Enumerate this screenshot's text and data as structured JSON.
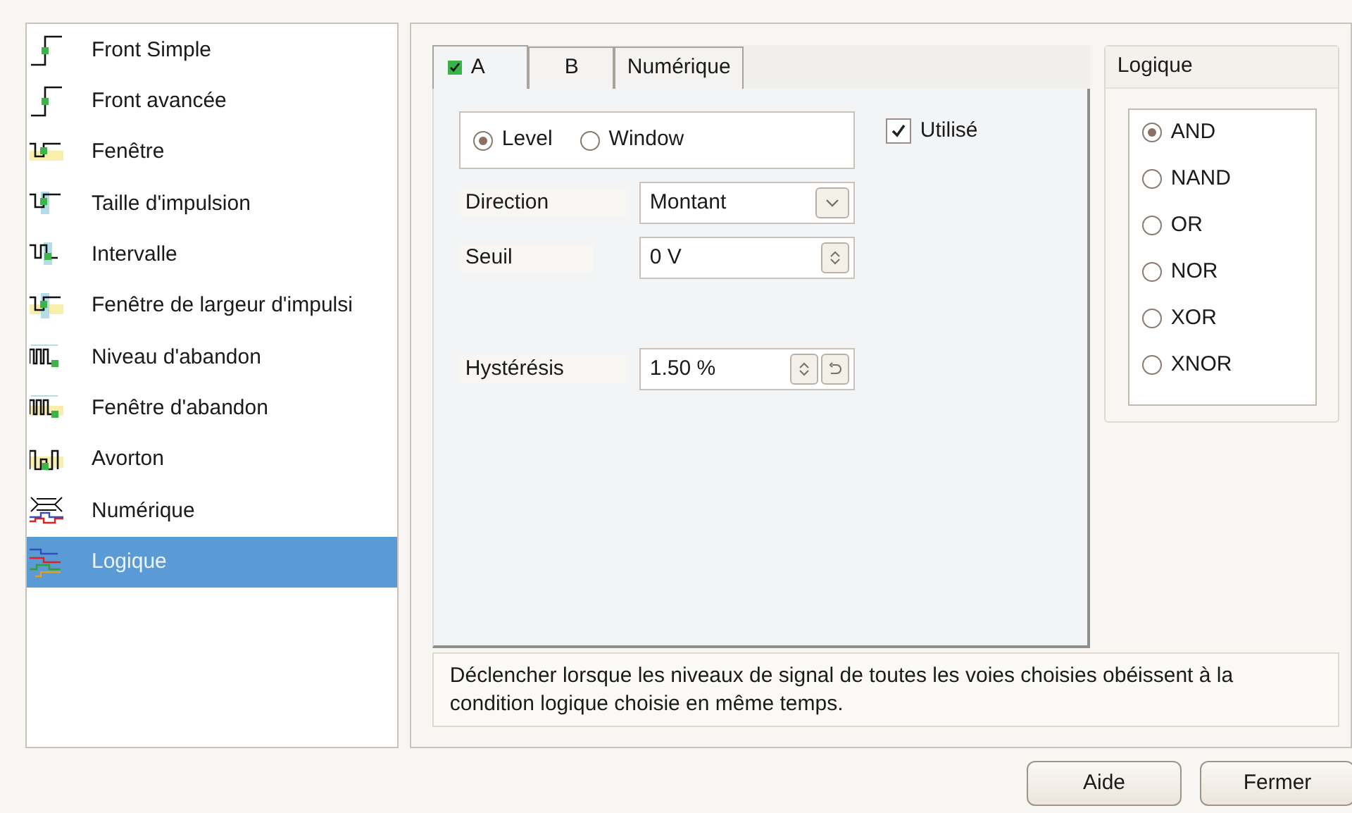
{
  "trigger_types": [
    {
      "label": "Front Simple",
      "selected": false
    },
    {
      "label": "Front avancée",
      "selected": false
    },
    {
      "label": "Fenêtre",
      "selected": false
    },
    {
      "label": "Taille d'impulsion",
      "selected": false
    },
    {
      "label": "Intervalle",
      "selected": false
    },
    {
      "label": "Fenêtre de largeur d'impulsi",
      "selected": false
    },
    {
      "label": "Niveau d'abandon",
      "selected": false
    },
    {
      "label": "Fenêtre d'abandon",
      "selected": false
    },
    {
      "label": "Avorton",
      "selected": false
    },
    {
      "label": "Numérique",
      "selected": false
    },
    {
      "label": "Logique",
      "selected": true
    }
  ],
  "tabs": [
    {
      "label": "A",
      "selected": true,
      "checked": true
    },
    {
      "label": "B",
      "selected": false
    },
    {
      "label": "Numérique",
      "selected": false
    }
  ],
  "mode": [
    {
      "label": "Level",
      "selected": true
    },
    {
      "label": "Window",
      "selected": false
    }
  ],
  "used": {
    "label": "Utilisé",
    "checked": true
  },
  "fields": [
    {
      "kind": "select",
      "label": "Direction",
      "value": "Montant"
    },
    {
      "kind": "spin",
      "label": "Seuil",
      "value": "0 V"
    },
    {
      "kind": "spin-reset",
      "label": "Hystérésis",
      "value": "1.50 %"
    }
  ],
  "logic": {
    "title": "Logique",
    "options": [
      {
        "label": "AND",
        "selected": true
      },
      {
        "label": "NAND",
        "selected": false
      },
      {
        "label": "OR",
        "selected": false
      },
      {
        "label": "NOR",
        "selected": false
      },
      {
        "label": "XOR",
        "selected": false
      },
      {
        "label": "XNOR",
        "selected": false
      }
    ]
  },
  "description": "Déclencher lorsque les niveaux de signal de toutes les voies choisies obéissent à la condition logique choisie en même temps.",
  "buttons": [
    "Aide",
    "Fermer"
  ]
}
